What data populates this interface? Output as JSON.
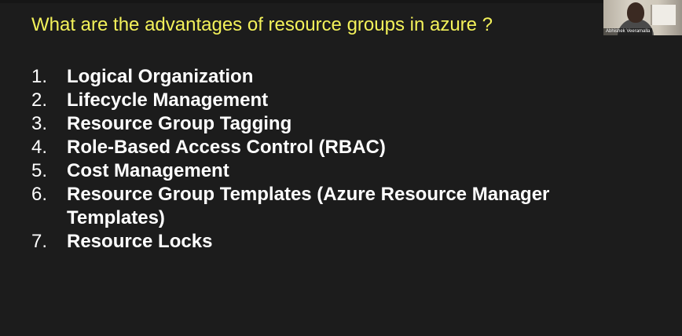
{
  "slide": {
    "title": "What are the advantages of resource groups in azure ?",
    "points": [
      {
        "number": "1.",
        "text": "Logical Organization"
      },
      {
        "number": "2.",
        "text": "Lifecycle Management"
      },
      {
        "number": "3.",
        "text": "Resource Group Tagging"
      },
      {
        "number": "4.",
        "text": "Role-Based Access Control (RBAC)"
      },
      {
        "number": "5.",
        "text": "Cost Management"
      },
      {
        "number": "6.",
        "text": "Resource Group Templates (Azure Resource Manager Templates)"
      },
      {
        "number": "7.",
        "text": "Resource Locks"
      }
    ]
  },
  "participant": {
    "name": "Abhishek Veeramalla"
  },
  "colors": {
    "background": "#1c1c1c",
    "title": "#f3f15a",
    "text": "#ffffff"
  }
}
